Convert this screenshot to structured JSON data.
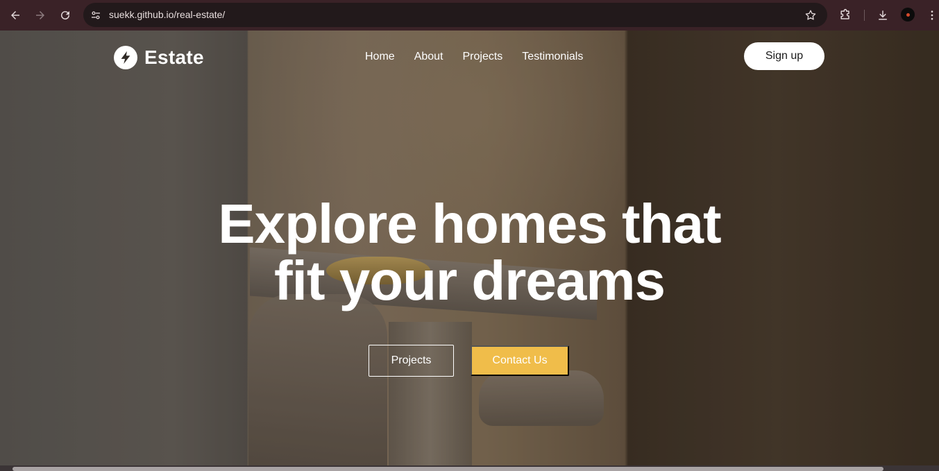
{
  "browser": {
    "url": "suekk.github.io/real-estate/",
    "icons": {
      "back": "arrow-left-icon",
      "forward": "arrow-right-icon",
      "reload": "reload-icon",
      "site_info": "tune-icon",
      "bookmark": "star-icon",
      "extensions": "puzzle-icon",
      "downloads": "download-icon",
      "menu": "kebab-menu-icon"
    }
  },
  "site": {
    "logo_text": "Estate",
    "nav": {
      "home": "Home",
      "about": "About",
      "projects": "Projects",
      "testimonials": "Testimonials"
    },
    "signup_label": "Sign up"
  },
  "hero": {
    "title_line1": "Explore homes that",
    "title_line2": "fit your dreams",
    "projects_button": "Projects",
    "contact_button": "Contact Us"
  },
  "colors": {
    "accent": "#f0bd4a",
    "browser_frame": "#3a2227",
    "omnibox": "#22191b"
  }
}
